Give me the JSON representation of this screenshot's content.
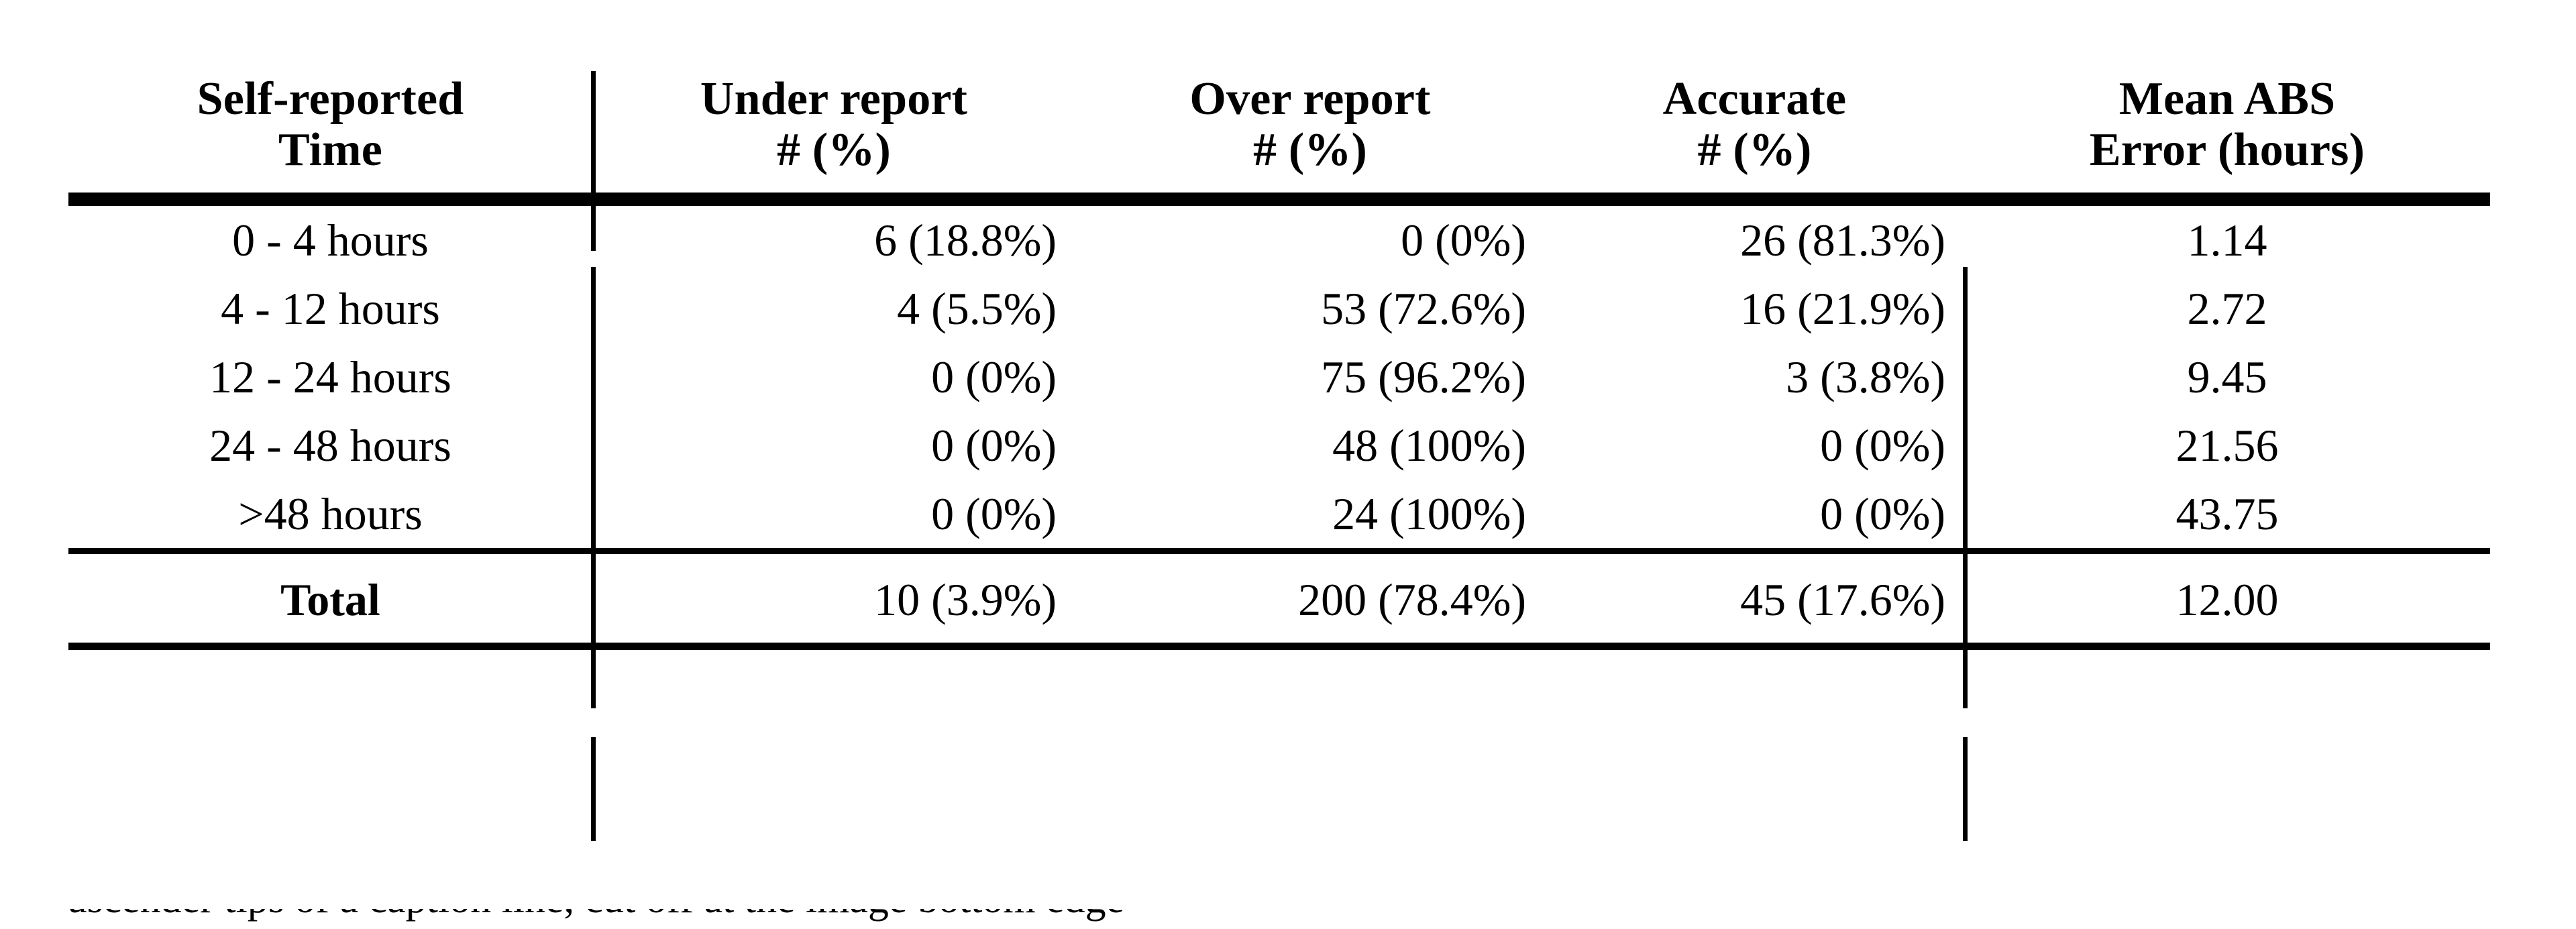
{
  "table": {
    "header": {
      "columns": [
        {
          "line1": "Self-reported",
          "line2": "Time"
        },
        {
          "line1": "Under report",
          "line2": "# (%)"
        },
        {
          "line1": "Over report",
          "line2": "# (%)"
        },
        {
          "line1": "Accurate",
          "line2": "# (%)"
        },
        {
          "line1": "Mean ABS",
          "line2": "Error (hours)"
        }
      ]
    },
    "rows": [
      {
        "label": "0 - 4 hours",
        "under": "6 (18.8%)",
        "over": "0 (0%)",
        "accurate": "26 (81.3%)",
        "mean": "1.14"
      },
      {
        "label": "4 - 12 hours",
        "under": "4 (5.5%)",
        "over": "53 (72.6%)",
        "accurate": "16 (21.9%)",
        "mean": "2.72"
      },
      {
        "label": "12 - 24 hours",
        "under": "0 (0%)",
        "over": "75 (96.2%)",
        "accurate": "3 (3.8%)",
        "mean": "9.45"
      },
      {
        "label": "24 - 48 hours",
        "under": "0 (0%)",
        "over": "48 (100%)",
        "accurate": "0 (0%)",
        "mean": "21.56"
      },
      {
        "label": ">48 hours",
        "under": "0 (0%)",
        "over": "24 (100%)",
        "accurate": "0 (0%)",
        "mean": "43.75"
      }
    ],
    "total": {
      "label": "Total",
      "under": "10 (3.9%)",
      "over": "200 (78.4%)",
      "accurate": "45 (17.6%)",
      "mean": "12.00"
    }
  },
  "caption": {
    "clipped_text": "ascender tips of a caption line, cut off at the image bottom edge"
  },
  "colors": {
    "rule": "#000000",
    "text": "#000000",
    "background": "#ffffff"
  },
  "chart_data": {
    "type": "table",
    "title": "",
    "columns": [
      "Self-reported Time",
      "Under report # (%)",
      "Over report # (%)",
      "Accurate # (%)",
      "Mean ABS Error (hours)"
    ],
    "rows": [
      [
        "0 - 4 hours",
        "6 (18.8%)",
        "0 (0%)",
        "26 (81.3%)",
        "1.14"
      ],
      [
        "4 - 12 hours",
        "4 (5.5%)",
        "53 (72.6%)",
        "16 (21.9%)",
        "2.72"
      ],
      [
        "12 - 24 hours",
        "0 (0%)",
        "75 (96.2%)",
        "3 (3.8%)",
        "9.45"
      ],
      [
        "24 - 48 hours",
        "0 (0%)",
        "48 (100%)",
        "0 (0%)",
        "21.56"
      ],
      [
        ">48 hours",
        "0 (0%)",
        "24 (100%)",
        "0 (0%)",
        "43.75"
      ],
      [
        "Total",
        "10 (3.9%)",
        "200 (78.4%)",
        "45 (17.6%)",
        "12.00"
      ]
    ],
    "under_report_counts": [
      6,
      4,
      0,
      0,
      0,
      10
    ],
    "under_report_pcts": [
      18.8,
      5.5,
      0,
      0,
      0,
      3.9
    ],
    "over_report_counts": [
      0,
      53,
      75,
      48,
      24,
      200
    ],
    "over_report_pcts": [
      0,
      72.6,
      96.2,
      100,
      100,
      78.4
    ],
    "accurate_counts": [
      26,
      16,
      3,
      0,
      0,
      45
    ],
    "accurate_pcts": [
      81.3,
      21.9,
      3.8,
      0,
      0,
      17.6
    ],
    "mean_abs_error_hours": [
      1.14,
      2.72,
      9.45,
      21.56,
      43.75,
      12.0
    ],
    "categories": [
      "0 - 4 hours",
      "4 - 12 hours",
      "12 - 24 hours",
      "24 - 48 hours",
      ">48 hours",
      "Total"
    ]
  }
}
